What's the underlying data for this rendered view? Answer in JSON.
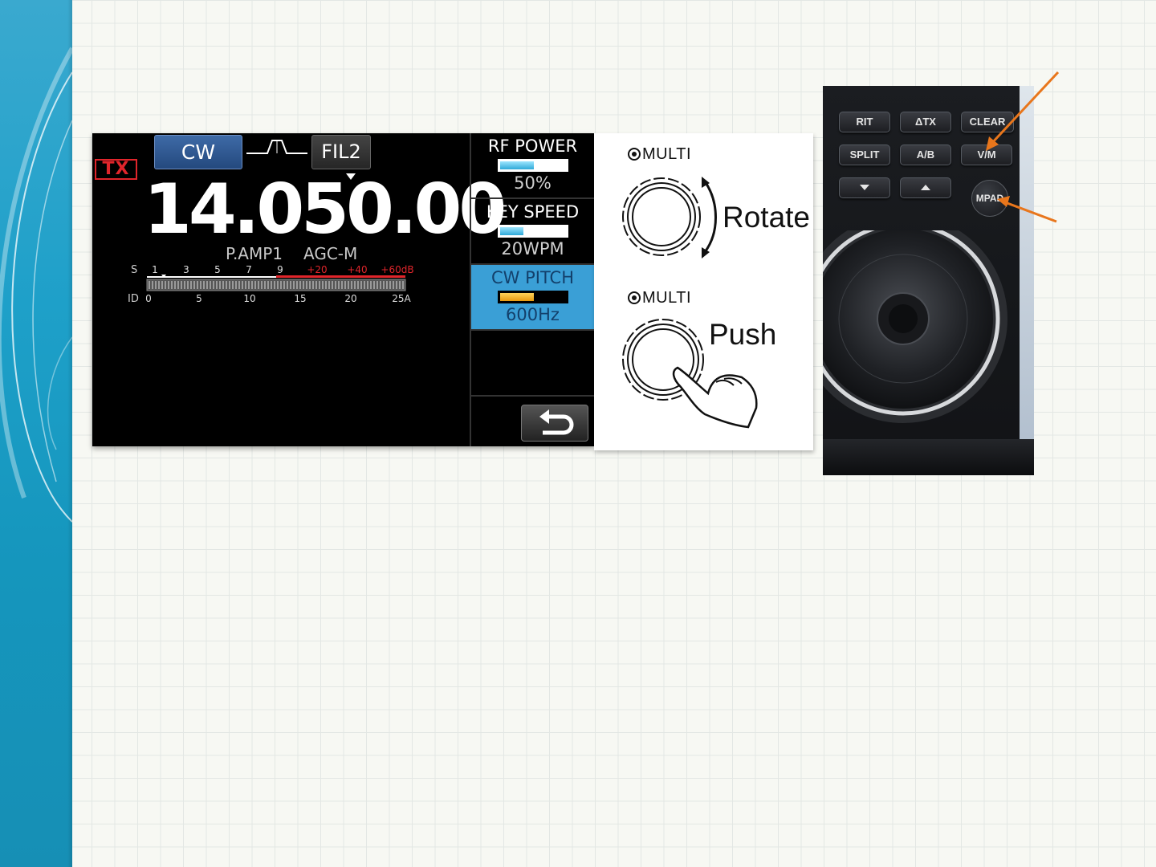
{
  "radio_screen": {
    "tx_badge": "TX",
    "mode": "CW",
    "filter": "FIL2",
    "frequency": "14.050.00",
    "preamp": "P.AMP1",
    "agc": "AGC-M",
    "meter_s_label": "S",
    "meter_s_ticks": [
      "1",
      "3",
      "5",
      "7",
      "9"
    ],
    "meter_s_plus_ticks": [
      "+20",
      "+40",
      "+60dB"
    ],
    "meter_id_label": "ID",
    "meter_id_ticks": [
      "0",
      "5",
      "10",
      "15",
      "20",
      "25A"
    ],
    "menu": [
      {
        "label": "RF POWER",
        "value": "50%",
        "level": 0.5,
        "active": false
      },
      {
        "label": "KEY SPEED",
        "value": "20WPM",
        "level": 0.35,
        "active": false
      },
      {
        "label": "CW PITCH",
        "value": "600Hz",
        "level": 0.5,
        "active": true
      }
    ],
    "back_icon": "return-arrow-icon"
  },
  "multi_panel": {
    "rotate_label": "MULTI",
    "rotate_text": "Rotate",
    "push_label": "MULTI",
    "push_text": "Push"
  },
  "radio_photo": {
    "keys_row1": [
      "RIT",
      "ΔTX",
      "CLEAR"
    ],
    "keys_row2": [
      "SPLIT",
      "A/B",
      "V/M"
    ],
    "mpad": "MPAD"
  },
  "colors": {
    "arrow": "#e8761c",
    "tx": "#e0252b",
    "active_menu": "#3a9fd6",
    "mode_button": "#2f5b96",
    "side_band": "#1ea0c9"
  }
}
